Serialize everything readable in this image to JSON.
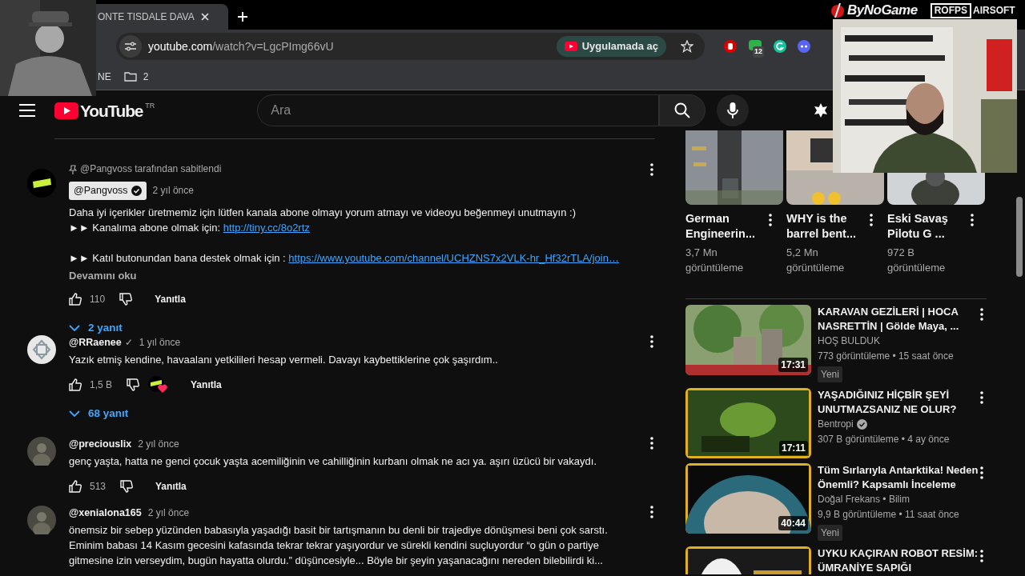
{
  "overlay": {
    "sponsors": [
      "ByNoGame",
      "ROFPS",
      "AIRSOFT"
    ]
  },
  "browser": {
    "tab_title": "ONTE TISDALE DAVA",
    "url_host": "youtube.com",
    "url_path": "/watch?v=LgcPImg66vU",
    "open_in_app": "Uygulamada aç",
    "extension_badge": "12",
    "bookmarks": [
      {
        "kind": "text",
        "label": "NE"
      },
      {
        "kind": "folder",
        "label": "2"
      }
    ]
  },
  "youtube": {
    "logo": "YouTube",
    "region": "TR",
    "search": {
      "placeholder": "Ara"
    }
  },
  "comments": [
    {
      "pinned_by": "@Pangvoss tarafından sabitlendi",
      "author": "@Pangvoss",
      "owner": true,
      "verified": true,
      "time": "2 yıl önce",
      "lines": [
        {
          "text": "Daha iyi içerikler üretmemiz için lütfen kanala abone olmayı yorum atmayı ve videoyu beğenmeyi unutmayın :)"
        },
        {
          "text": "►► Kanalıma abone olmak için: ",
          "link": "http://tiny.cc/8o2rtz"
        },
        {
          "text": "►► Katıl butonundan bana destek olmak için : ",
          "link": "https://www.youtube.com/channel/UCHZNS7x2VLK-hr_Hf32rTLA/join…",
          "gap_before": true
        }
      ],
      "read_more": "Devamını oku",
      "likes": "110",
      "reply": "Yanıtla",
      "replies": "2 yanıt"
    },
    {
      "author": "@RRaenee",
      "check": "✓",
      "time": "1 yıl önce",
      "lines": [
        {
          "text": "Yazık etmiş kendine, havaalanı yetkilileri hesap vermeli. Davayı kaybettiklerine çok şaşırdım.."
        }
      ],
      "likes": "1,5 B",
      "creator_heart": true,
      "reply": "Yanıtla",
      "replies": "68 yanıt"
    },
    {
      "author": "@preciouslix",
      "time": "2 yıl önce",
      "lines": [
        {
          "text": "genç yaşta, hatta ne genci çocuk yaşta acemiliğinin ve cahilliğinin kurbanı olmak ne acı ya. aşırı üzücü bir vakaydı."
        }
      ],
      "likes": "513",
      "reply": "Yanıtla"
    },
    {
      "author": "@xenialona165",
      "time": "2 yıl önce",
      "lines": [
        {
          "text": "önemsiz bir sebep yüzünden babasıyla yaşadığı basit bir tartışmanın bu denli bir trajediye dönüşmesi beni çok sarstı. Eminim babası 14 Kasım gecesini kafasında tekrar tekrar yaşıyordur ve sürekli kendini suçluyordur “o gün o partiye gitmesine izin verseydim, bugün hayatta olurdu.” düşüncesiyle... Böyle bir şeyin yaşanacağını nereden bilebilirdi ki..."
        }
      ]
    }
  ],
  "shorts": [
    {
      "title": "German Engineerin...",
      "views": "3,7 Mn görüntüleme"
    },
    {
      "title": "WHY is the barrel bent...",
      "views": "5,2 Mn görüntüleme"
    },
    {
      "title": "Eski Savaş Pilotu G ...",
      "views": "972 B görüntüleme"
    }
  ],
  "videos": [
    {
      "title": "KARAVAN GEZİLERİ | HOCA NASRETTİN | Gölde Maya, ...",
      "channel": "HOŞ BULDUK",
      "meta": "773 görüntüleme • 15 saat önce",
      "badge": "Yeni",
      "duration": "17:31"
    },
    {
      "title": "YAŞADIĞINIZ HİÇBİR ŞEYİ UNUTMAZSANIZ NE OLUR?",
      "channel": "Bentropi",
      "verified": true,
      "meta": "307 B görüntüleme • 4 ay önce",
      "duration": "17:11"
    },
    {
      "title": "Tüm Sırlarıyla Antarktika! Neden Önemli? Kapsamlı İnceleme",
      "channel": "Doğal Frekans • Bilim",
      "meta": "9,9 B görüntüleme • 11 saat önce",
      "badge": "Yeni",
      "duration": "40:44"
    },
    {
      "title": "UYKU KAÇIRAN ROBOT RESİM: ÜMRANİYE SAPIĞI"
    }
  ]
}
